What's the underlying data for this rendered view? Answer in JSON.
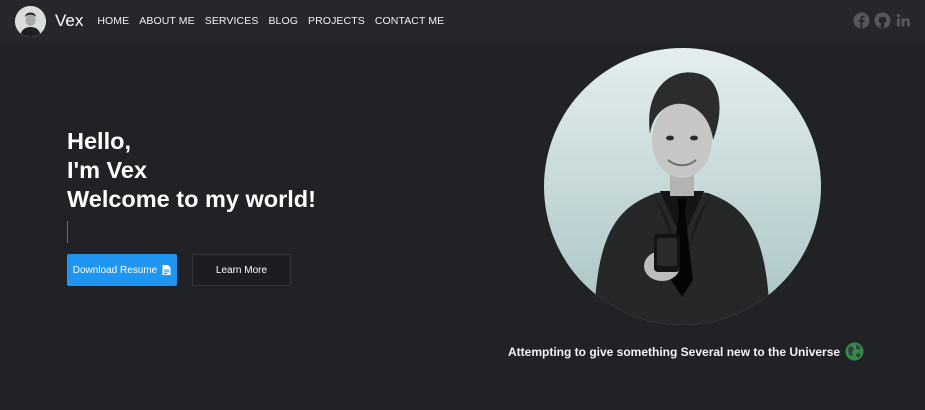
{
  "brand": {
    "name": "Vex"
  },
  "nav": {
    "items": [
      {
        "label": "HOME"
      },
      {
        "label": "ABOUT ME"
      },
      {
        "label": "SERVICES"
      },
      {
        "label": "BLOG"
      },
      {
        "label": "PROJECTS"
      },
      {
        "label": "CONTACT ME"
      }
    ]
  },
  "social": {
    "icons": [
      "facebook-icon",
      "github-icon",
      "linkedin-icon"
    ]
  },
  "hero": {
    "line1": "Hello,",
    "line2": "I'm Vex",
    "line3": "Welcome to my world!",
    "primary_button": "Download Resume",
    "secondary_button": "Learn More",
    "tagline": "Attempting to give something Several new to the Universe"
  },
  "colors": {
    "background": "#202226",
    "navbar": "#25272b",
    "accent": "#1e95f0",
    "cursor": "#2e8b57"
  }
}
